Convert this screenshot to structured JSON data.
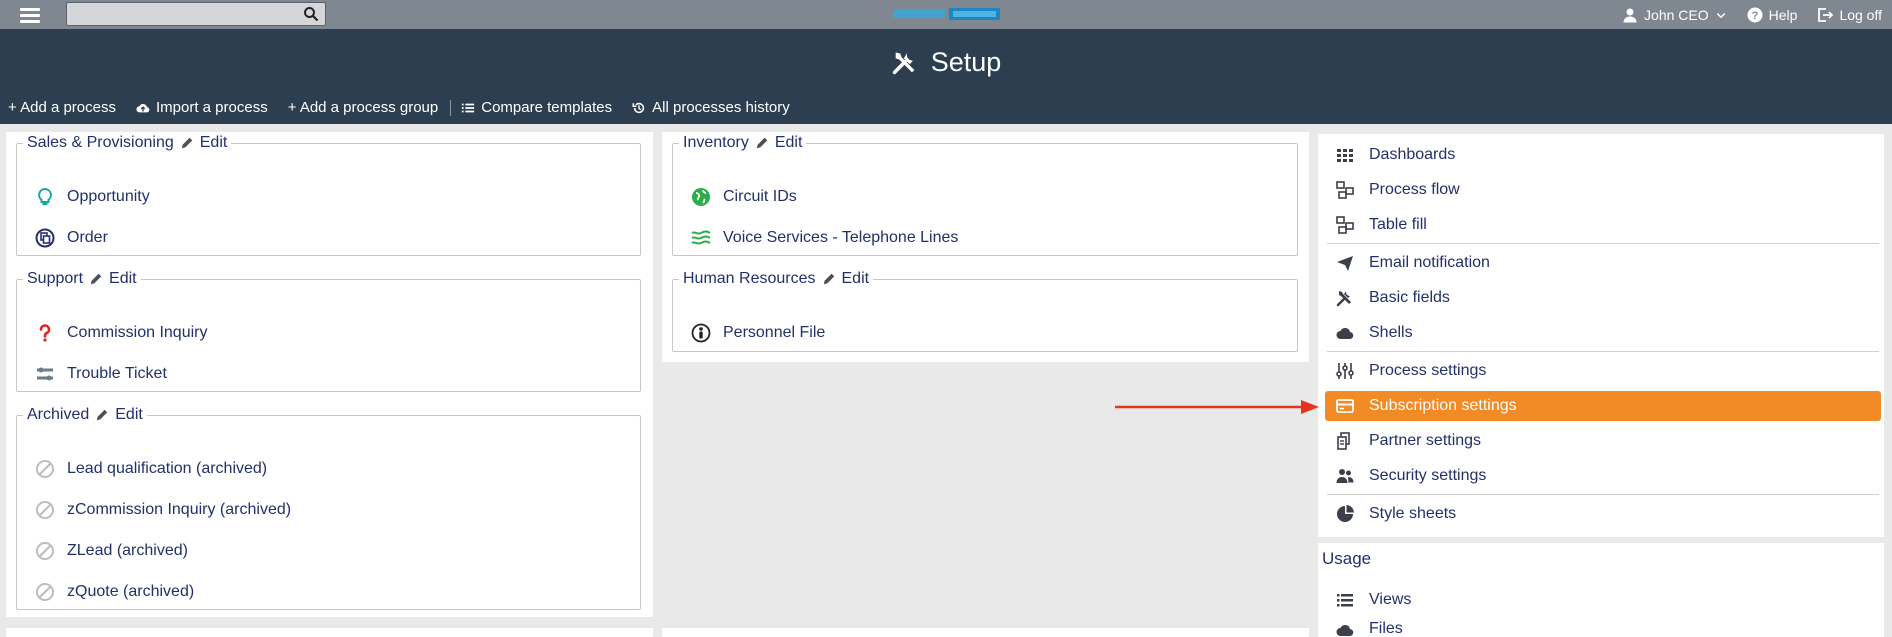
{
  "topbar": {
    "search_value": "",
    "user": "John CEO",
    "help": "Help",
    "logoff": "Log off"
  },
  "header": {
    "title": "Setup"
  },
  "toolbar": {
    "add_process": "+ Add a process",
    "import_process": "Import a process",
    "add_group": "+ Add a process group",
    "compare": "Compare templates",
    "history": "All processes history"
  },
  "groups": {
    "sales": {
      "name": "Sales & Provisioning",
      "edit": "Edit",
      "items": [
        "Opportunity",
        "Order"
      ]
    },
    "support": {
      "name": "Support",
      "edit": "Edit",
      "items": [
        "Commission Inquiry",
        "Trouble Ticket"
      ]
    },
    "archived": {
      "name": "Archived",
      "edit": "Edit",
      "items": [
        "Lead qualification (archived)",
        "zCommission Inquiry (archived)",
        "ZLead (archived)",
        "zQuote (archived)"
      ]
    },
    "inventory": {
      "name": "Inventory",
      "edit": "Edit",
      "items": [
        "Circuit IDs",
        "Voice Services - Telephone Lines"
      ]
    },
    "hr": {
      "name": "Human Resources",
      "edit": "Edit",
      "items": [
        "Personnel File"
      ]
    }
  },
  "settings": {
    "items": [
      {
        "label": "Dashboards",
        "icon": "grid-icon"
      },
      {
        "label": "Process flow",
        "icon": "flow-icon"
      },
      {
        "label": "Table fill",
        "icon": "flow-icon"
      },
      {
        "label": "Email notification",
        "icon": "paper-plane-icon"
      },
      {
        "label": "Basic fields",
        "icon": "tools-icon"
      },
      {
        "label": "Shells",
        "icon": "cloud-icon"
      },
      {
        "label": "Process settings",
        "icon": "sliders-icon"
      },
      {
        "label": "Subscription settings",
        "icon": "credit-card-icon"
      },
      {
        "label": "Partner settings",
        "icon": "partner-icon"
      },
      {
        "label": "Security settings",
        "icon": "users-icon"
      },
      {
        "label": "Style sheets",
        "icon": "pie-chart-icon"
      }
    ],
    "active": "Subscription settings"
  },
  "usage": {
    "title": "Usage",
    "items": [
      "Views",
      "Files"
    ]
  },
  "colors": {
    "topbar": "#7f8791",
    "header": "#2d3e50",
    "link": "#22306b",
    "active": "#f28a26",
    "arrow": "#e8321e"
  }
}
